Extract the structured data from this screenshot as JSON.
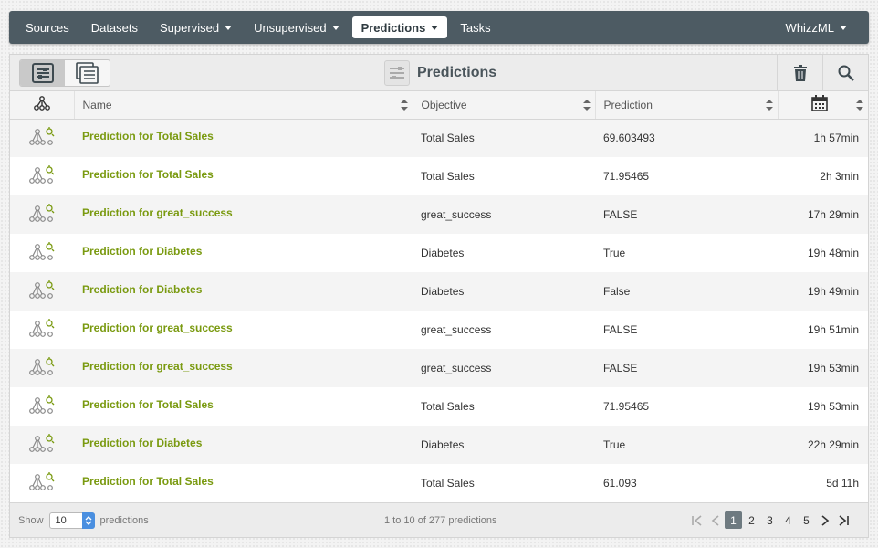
{
  "nav": {
    "items": [
      {
        "label": "Sources",
        "dropdown": false,
        "active": false
      },
      {
        "label": "Datasets",
        "dropdown": false,
        "active": false
      },
      {
        "label": "Supervised",
        "dropdown": true,
        "active": false
      },
      {
        "label": "Unsupervised",
        "dropdown": true,
        "active": false
      },
      {
        "label": "Predictions",
        "dropdown": true,
        "active": true
      },
      {
        "label": "Tasks",
        "dropdown": false,
        "active": false
      }
    ],
    "user_menu": "WhizzML"
  },
  "toolbar": {
    "title": "Predictions",
    "title_icon": "prediction-list-icon",
    "view_buttons": [
      "list-view-icon",
      "composite-view-icon"
    ],
    "actions": [
      "trash-icon",
      "search-icon"
    ]
  },
  "table": {
    "columns": {
      "type": "model-type-icon",
      "name": "Name",
      "objective": "Objective",
      "prediction": "Prediction",
      "age": "calendar-icon"
    },
    "rows": [
      {
        "name": "Prediction for Total Sales",
        "objective": "Total Sales",
        "prediction": "69.603493",
        "age": "1h 57min"
      },
      {
        "name": "Prediction for Total Sales",
        "objective": "Total Sales",
        "prediction": "71.95465",
        "age": "2h 3min"
      },
      {
        "name": "Prediction for great_success",
        "objective": "great_success",
        "prediction": "FALSE",
        "age": "17h 29min"
      },
      {
        "name": "Prediction for Diabetes",
        "objective": "Diabetes",
        "prediction": "True",
        "age": "19h 48min"
      },
      {
        "name": "Prediction for Diabetes",
        "objective": "Diabetes",
        "prediction": "False",
        "age": "19h 49min"
      },
      {
        "name": "Prediction for great_success",
        "objective": "great_success",
        "prediction": "FALSE",
        "age": "19h 51min"
      },
      {
        "name": "Prediction for great_success",
        "objective": "great_success",
        "prediction": "FALSE",
        "age": "19h 53min"
      },
      {
        "name": "Prediction for Total Sales",
        "objective": "Total Sales",
        "prediction": "71.95465",
        "age": "19h 53min"
      },
      {
        "name": "Prediction for Diabetes",
        "objective": "Diabetes",
        "prediction": "True",
        "age": "22h 29min"
      },
      {
        "name": "Prediction for Total Sales",
        "objective": "Total Sales",
        "prediction": "61.093",
        "age": "5d 11h"
      }
    ]
  },
  "footer": {
    "show_label": "Show",
    "per_page": "10",
    "per_page_suffix": "predictions",
    "count_text": "1 to 10 of 277 predictions",
    "pages": [
      "1",
      "2",
      "3",
      "4",
      "5"
    ],
    "current_page": "1"
  },
  "colors": {
    "nav_bg": "#4d5b63",
    "link_green": "#7a9a10",
    "pager_current": "#6e7a80",
    "spinner_blue": "#4a8fe0"
  }
}
